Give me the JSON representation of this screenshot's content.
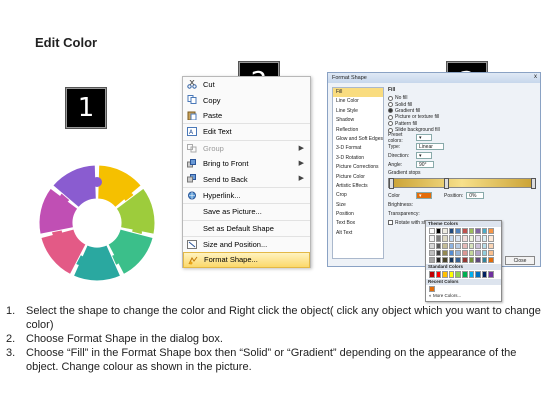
{
  "title": "Edit Color",
  "badges": [
    "1",
    "2",
    "3"
  ],
  "menu": {
    "items": [
      {
        "label": "Cut",
        "icon": "scissors-icon",
        "submenu": false,
        "disabled": false
      },
      {
        "label": "Copy",
        "icon": "copy-icon",
        "submenu": false,
        "disabled": false
      },
      {
        "label": "Paste",
        "icon": "paste-icon",
        "submenu": false,
        "disabled": false
      },
      {
        "label": "Edit Text",
        "icon": "edit-text-icon",
        "submenu": false,
        "disabled": false
      },
      {
        "label": "Group",
        "icon": "group-icon",
        "submenu": true,
        "disabled": true
      },
      {
        "label": "Bring to Front",
        "icon": "bring-front-icon",
        "submenu": true,
        "disabled": false
      },
      {
        "label": "Send to Back",
        "icon": "send-back-icon",
        "submenu": true,
        "disabled": false
      },
      {
        "label": "Hyperlink...",
        "icon": "hyperlink-icon",
        "submenu": false,
        "disabled": false
      },
      {
        "label": "Save as Picture...",
        "icon": "",
        "submenu": false,
        "disabled": false
      },
      {
        "label": "Set as Default Shape",
        "icon": "",
        "submenu": false,
        "disabled": false
      },
      {
        "label": "Size and Position...",
        "icon": "size-icon",
        "submenu": false,
        "disabled": false
      },
      {
        "label": "Format Shape...",
        "icon": "format-shape-icon",
        "submenu": false,
        "disabled": false,
        "highlighted": true
      }
    ]
  },
  "dialog": {
    "title": "Format Shape",
    "close_glyph": "x",
    "categories": [
      "Fill",
      "Line Color",
      "Line Style",
      "Shadow",
      "Reflection",
      "Glow and Soft Edges",
      "3-D Format",
      "3-D Rotation",
      "Picture Corrections",
      "Picture Color",
      "Artistic Effects",
      "Crop",
      "Size",
      "Position",
      "Text Box",
      "Alt Text"
    ],
    "selected_category": "Fill",
    "fill_heading": "Fill",
    "fill_options": [
      {
        "label": "No fill",
        "checked": false
      },
      {
        "label": "Solid fill",
        "checked": false
      },
      {
        "label": "Gradient fill",
        "checked": true
      },
      {
        "label": "Picture or texture fill",
        "checked": false
      },
      {
        "label": "Pattern fill",
        "checked": false
      },
      {
        "label": "Slide background fill",
        "checked": false
      }
    ],
    "preset_label": "Preset colors:",
    "type_label": "Type:",
    "type_value": "Linear",
    "direction_label": "Direction:",
    "angle_label": "Angle:",
    "angle_value": "90°",
    "stops_label": "Gradient stops",
    "color_label": "Color",
    "position_label": "Position:",
    "position_value": "0%",
    "brightness_label": "Brightness:",
    "transparency_label": "Transparency:",
    "rotate_label": "Rotate with shape",
    "close_label": "Close",
    "palette": {
      "theme_label": "Theme Colors",
      "standard_label": "Standard Colors",
      "recent_label": "Recent Colors",
      "more_label": "More Colors...",
      "theme_colors": [
        "#ffffff",
        "#000000",
        "#eeece1",
        "#1f497d",
        "#4f81bd",
        "#c0504d",
        "#9bbb59",
        "#8064a2",
        "#4bacc6",
        "#f79646",
        "#f2f2f2",
        "#7f7f7f",
        "#ddd9c3",
        "#c6d9f0",
        "#dbe5f1",
        "#f2dcdb",
        "#ebf1dd",
        "#e5e0ec",
        "#dbeef3",
        "#fdeada",
        "#d8d8d8",
        "#595959",
        "#c4bd97",
        "#8db3e2",
        "#b8cce4",
        "#e5b9b7",
        "#d7e3bc",
        "#ccc1d9",
        "#b7dde8",
        "#fbd5b5",
        "#bfbfbf",
        "#3f3f3f",
        "#938953",
        "#548dd4",
        "#95b3d7",
        "#d99694",
        "#c3d69b",
        "#b2a2c7",
        "#92cddc",
        "#fac08f",
        "#a5a5a5",
        "#262626",
        "#494429",
        "#17365d",
        "#366092",
        "#953734",
        "#76923c",
        "#5f497a",
        "#31859b",
        "#e36c09"
      ],
      "standard_colors": [
        "#c00000",
        "#ff0000",
        "#ffc000",
        "#ffff00",
        "#92d050",
        "#00b050",
        "#00b0f0",
        "#0070c0",
        "#002060",
        "#7030a0"
      ],
      "recent_colors": [
        "#e36c09"
      ]
    }
  },
  "wheel": {
    "segments": [
      "#f5c000",
      "#9dcc3c",
      "#3bbf8a",
      "#2aa8a0",
      "#e35a86",
      "#c04fb4",
      "#8a5cd0"
    ]
  },
  "steps": [
    {
      "num": "1.",
      "text": "Select the shape to change the color and Right click the object( click any object which you want to change color)"
    },
    {
      "num": "2.",
      "text": "Choose Format Shape in the dialog box."
    },
    {
      "num": "3.",
      "text": "Choose “Fill” in the Format Shape box then “Solid” or “Gradient” depending on the appearance of the object. Change colour as shown in the picture."
    }
  ]
}
